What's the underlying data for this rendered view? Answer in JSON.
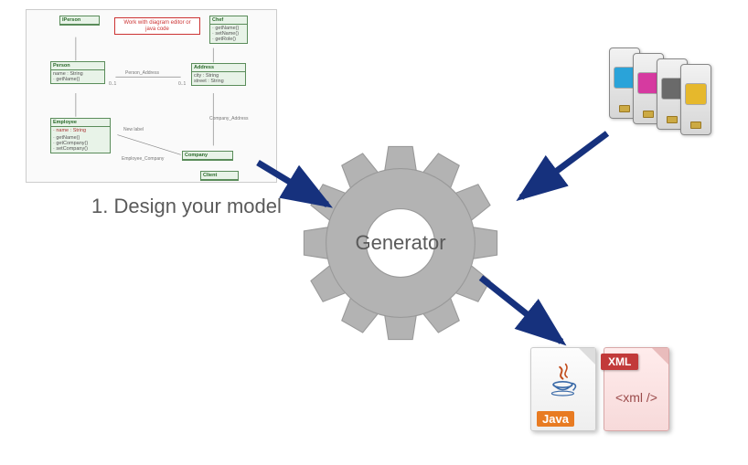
{
  "uml": {
    "note": "Work with diagram editor or java code",
    "classes": {
      "iperson": "IPerson",
      "chef": "Chef",
      "person": "Person",
      "address": "Address",
      "employee": "Employee",
      "company": "Company",
      "client": "Client"
    },
    "assoc_labels": {
      "person_address": "Person_Address",
      "company_address": "Company_Address",
      "employee_company": "Employee_Company",
      "new_label": "New label",
      "multiplicity": "0..1",
      "attr_name": "name : String",
      "attr_city": "city : String",
      "attr_street": "street : String"
    }
  },
  "step": {
    "caption": "1. Design your model"
  },
  "gear": {
    "label": "Generator"
  },
  "cartridges": {
    "colors": [
      "#2aa3d9",
      "#d63aa0",
      "#6a6a6a",
      "#e6b82c"
    ]
  },
  "outputs": {
    "java_label": "Java",
    "xml_banner": "XML",
    "xml_content": "<xml />"
  }
}
